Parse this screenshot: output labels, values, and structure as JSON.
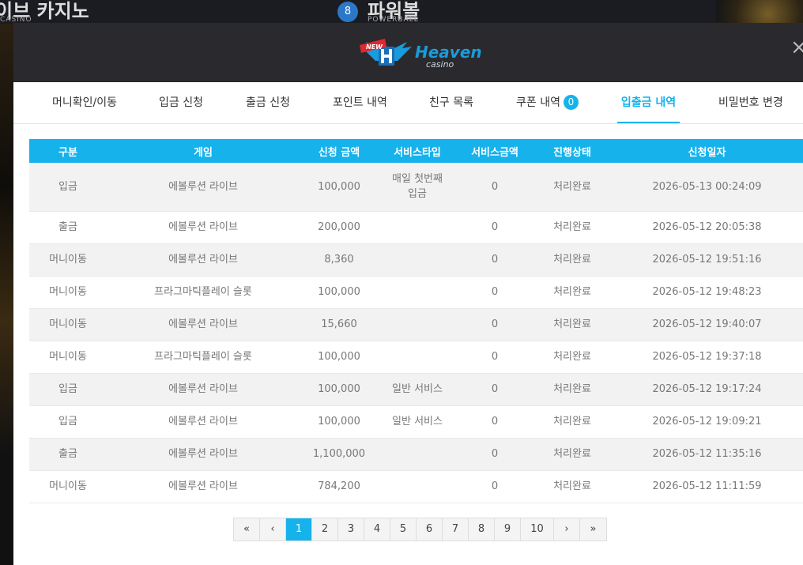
{
  "background": {
    "left_tile_text": "이브 카지노",
    "left_tile_sub": "CASINO",
    "mid_tile_text": "파워볼",
    "mid_tile_sub": "POWERBALL",
    "ball_number": "8"
  },
  "modal": {
    "brand_badge": "NEW",
    "brand_name": "Heaven",
    "brand_sub": "casino",
    "close_label": "×"
  },
  "tabs": [
    {
      "label": "머니확인/이동"
    },
    {
      "label": "입금 신청"
    },
    {
      "label": "출금 신청"
    },
    {
      "label": "포인트 내역"
    },
    {
      "label": "친구 목록"
    },
    {
      "label": "쿠폰 내역",
      "badge": "0"
    },
    {
      "label": "입출금 내역"
    },
    {
      "label": "비밀번호 변경"
    }
  ],
  "table": {
    "headers": [
      "구분",
      "게임",
      "신청 금액",
      "서비스타입",
      "서비스금액",
      "진행상태",
      "신청일자"
    ],
    "rows": [
      {
        "type": "입금",
        "game": "에볼루션 라이브",
        "amount": "100,000",
        "service": "매일 첫번째 입금",
        "service_amount": "0",
        "status": "처리완료",
        "date": "2026-05-13 00:24:09"
      },
      {
        "type": "출금",
        "game": "에볼루션 라이브",
        "amount": "200,000",
        "service": "",
        "service_amount": "0",
        "status": "처리완료",
        "date": "2026-05-12 20:05:38"
      },
      {
        "type": "머니이동",
        "game": "에볼루션 라이브",
        "amount": "8,360",
        "service": "",
        "service_amount": "0",
        "status": "처리완료",
        "date": "2026-05-12 19:51:16"
      },
      {
        "type": "머니이동",
        "game": "프라그마틱플레이 슬롯",
        "amount": "100,000",
        "service": "",
        "service_amount": "0",
        "status": "처리완료",
        "date": "2026-05-12 19:48:23"
      },
      {
        "type": "머니이동",
        "game": "에볼루션 라이브",
        "amount": "15,660",
        "service": "",
        "service_amount": "0",
        "status": "처리완료",
        "date": "2026-05-12 19:40:07"
      },
      {
        "type": "머니이동",
        "game": "프라그마틱플레이 슬롯",
        "amount": "100,000",
        "service": "",
        "service_amount": "0",
        "status": "처리완료",
        "date": "2026-05-12 19:37:18"
      },
      {
        "type": "입금",
        "game": "에볼루션 라이브",
        "amount": "100,000",
        "service": "일반 서비스",
        "service_amount": "0",
        "status": "처리완료",
        "date": "2026-05-12 19:17:24"
      },
      {
        "type": "입금",
        "game": "에볼루션 라이브",
        "amount": "100,000",
        "service": "일반 서비스",
        "service_amount": "0",
        "status": "처리완료",
        "date": "2026-05-12 19:09:21"
      },
      {
        "type": "출금",
        "game": "에볼루션 라이브",
        "amount": "1,100,000",
        "service": "",
        "service_amount": "0",
        "status": "처리완료",
        "date": "2026-05-12 11:35:16"
      },
      {
        "type": "머니이동",
        "game": "에볼루션 라이브",
        "amount": "784,200",
        "service": "",
        "service_amount": "0",
        "status": "처리완료",
        "date": "2026-05-12 11:11:59"
      }
    ]
  },
  "pagination": {
    "first": "«",
    "prev": "‹",
    "pages": [
      "1",
      "2",
      "3",
      "4",
      "5",
      "6",
      "7",
      "8",
      "9",
      "10"
    ],
    "current": "1",
    "next": "›",
    "last": "»"
  },
  "colors": {
    "accent": "#16b2ec",
    "header_bg": "#2a2a2e"
  }
}
